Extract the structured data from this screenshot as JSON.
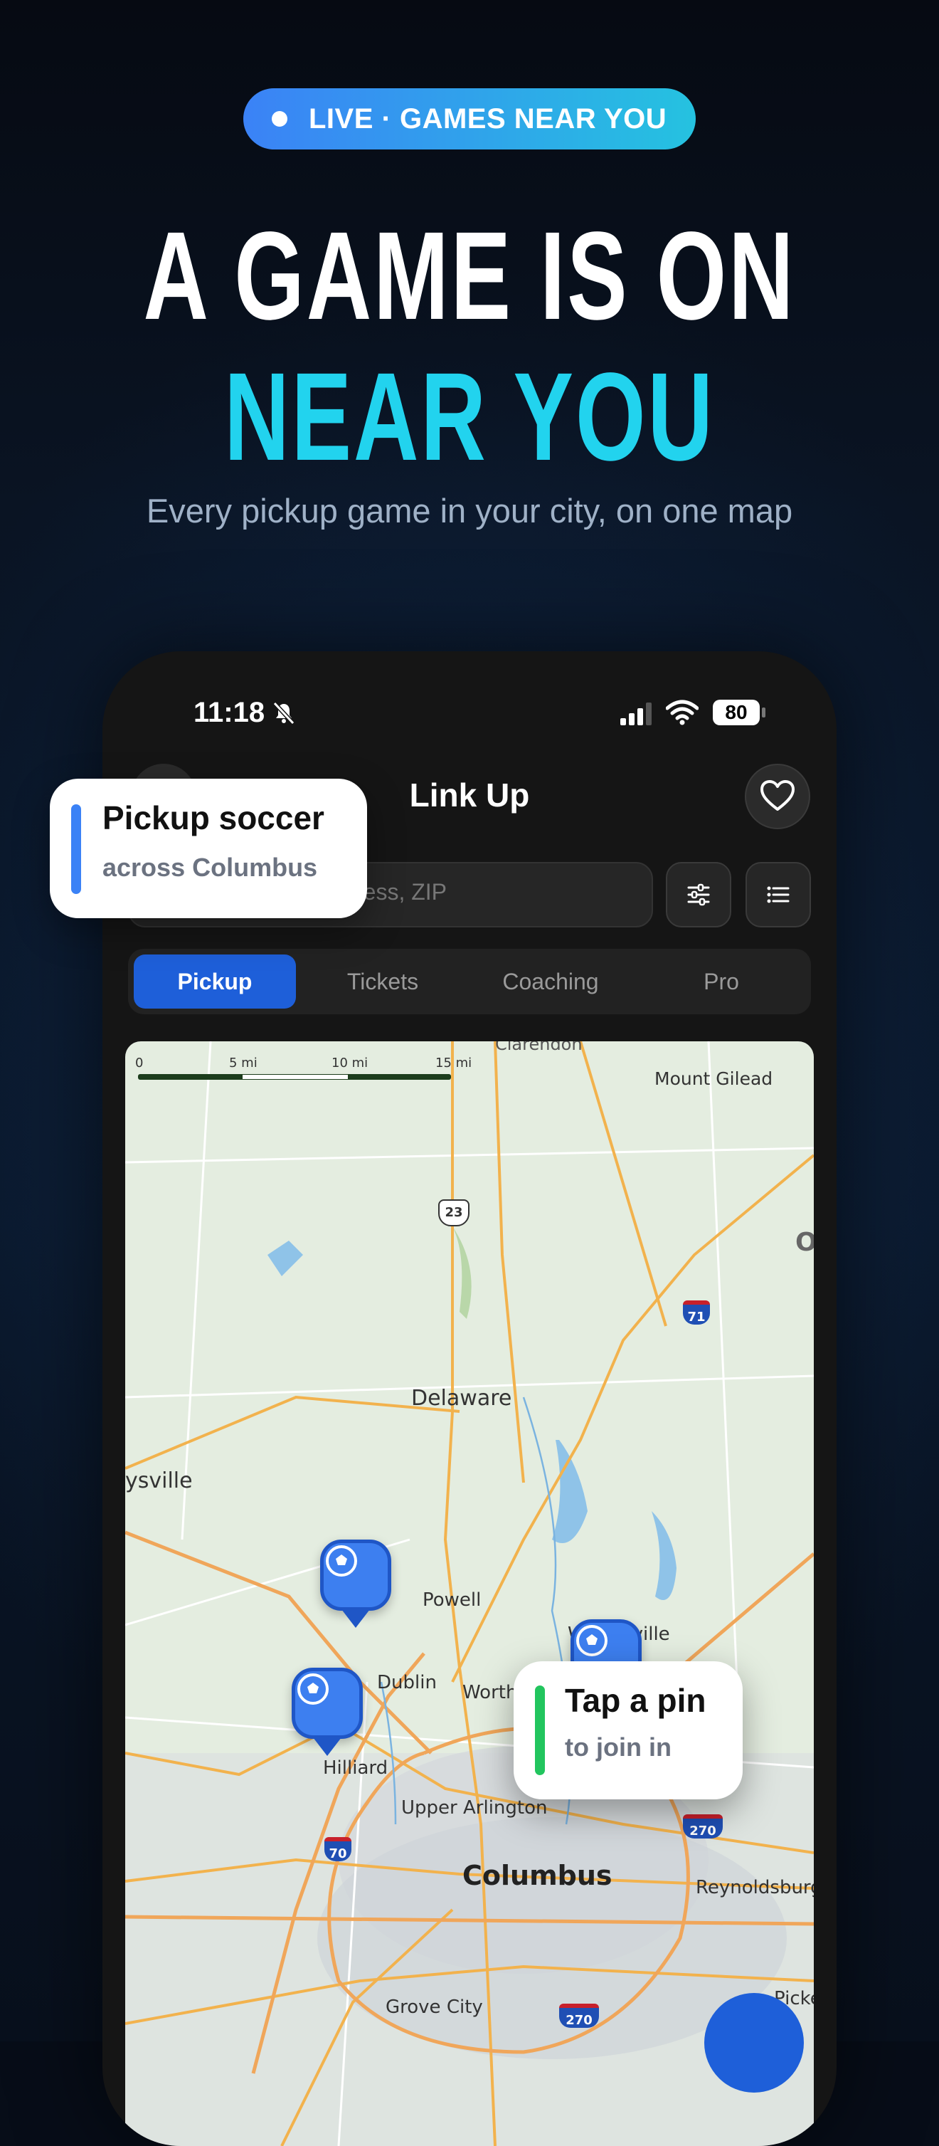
{
  "badge": {
    "text": "LIVE · GAMES NEAR YOU"
  },
  "headline": {
    "line1": "A GAME IS ON",
    "line2": "NEAR YOU"
  },
  "subtitle": "Every pickup game in your city, on one map",
  "phone": {
    "status": {
      "time": "11:18",
      "battery": "80"
    },
    "app_title": "Link Up",
    "search": {
      "placeholder_visible": "ress, ZIP"
    },
    "tabs": [
      {
        "label": "Pickup",
        "active": true
      },
      {
        "label": "Tickets",
        "active": false
      },
      {
        "label": "Coaching",
        "active": false
      },
      {
        "label": "Pro",
        "active": false
      }
    ],
    "map": {
      "scale": [
        "0",
        "5 mi",
        "10 mi",
        "15 mi"
      ],
      "labels": {
        "clarendon": "Clarendon",
        "mount_gilead": "Mount Gilead",
        "us23": "23",
        "i71": "71",
        "edge_o": "O",
        "delaware": "Delaware",
        "marysville": "ysville",
        "powell": "Powell",
        "westerville": "Westerville",
        "dublin": "Dublin",
        "worthington": "Worth",
        "hilliard": "Hilliard",
        "upper_arlington": "Upper Arlington",
        "i70": "70",
        "i270_east": "270",
        "columbus": "Columbus",
        "reynoldsburg": "Reynoldsburg",
        "grove_city": "Grove City",
        "i270_south": "270",
        "pickerington": "Picke"
      }
    }
  },
  "callouts": {
    "pickup": {
      "title": "Pickup soccer",
      "subtitle": "across Columbus"
    },
    "tap": {
      "title": "Tap a pin",
      "subtitle": "to join in"
    }
  },
  "colors": {
    "accent": "#1e5fd9",
    "cyan": "#22d3ee",
    "green": "#22c55e",
    "pin": "#3d7ff0"
  }
}
